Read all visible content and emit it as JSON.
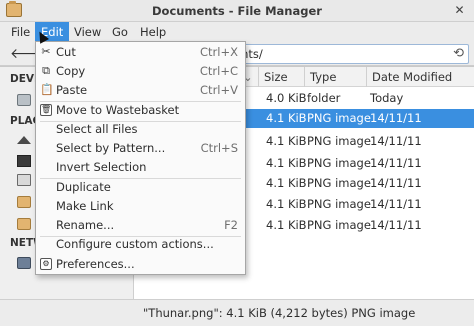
{
  "window": {
    "title": "Documents - File Manager",
    "close_glyph": "✕",
    "app_icon": "folder-icon"
  },
  "menubar": {
    "items": [
      "File",
      "Edit",
      "View",
      "Go",
      "Help"
    ],
    "active": "Edit"
  },
  "toolbar": {
    "back_glyph": "🡐",
    "path": "ents/",
    "reload_glyph": "⟲"
  },
  "sidebar": {
    "devices_heading": "DEVI",
    "places_heading": "PLAC",
    "network_heading": "NETW"
  },
  "columns": {
    "size": "Size",
    "type": "Type",
    "date": "Date Modified",
    "sort_glyph": "⌄"
  },
  "files": [
    {
      "size": "4.0 KiB",
      "type": "folder",
      "date": "Today",
      "selected": false
    },
    {
      "size": "4.1 KiB",
      "type": "PNG image",
      "date": "14/11/11",
      "selected": true
    },
    {
      "size": "4.1 KiB",
      "type": "PNG image",
      "date": "14/11/11",
      "selected": false
    },
    {
      "size": "4.1 KiB",
      "type": "PNG image",
      "date": "14/11/11",
      "selected": false
    },
    {
      "size": "4.1 KiB",
      "type": "PNG image",
      "date": "14/11/11",
      "selected": false
    },
    {
      "size": "4.1 KiB",
      "type": "PNG image",
      "date": "14/11/11",
      "selected": false
    },
    {
      "size": "4.1 KiB",
      "type": "PNG image",
      "date": "14/11/11",
      "selected": false
    }
  ],
  "status": "\"Thunar.png\": 4.1 KiB (4,212 bytes) PNG image",
  "edit_menu": {
    "cut": {
      "label": "Cut",
      "accel": "Ctrl+X",
      "icon": "✂"
    },
    "copy": {
      "label": "Copy",
      "accel": "Ctrl+C",
      "icon": "⧉"
    },
    "paste": {
      "label": "Paste",
      "accel": "Ctrl+V",
      "icon": "📋"
    },
    "wastebasket": {
      "label": "Move to Wastebasket",
      "icon": "🗑"
    },
    "select_all": {
      "label": "Select all Files"
    },
    "select_pattern": {
      "label": "Select by Pattern...",
      "accel": "Ctrl+S"
    },
    "invert": {
      "label": "Invert Selection"
    },
    "duplicate": {
      "label": "Duplicate"
    },
    "make_link": {
      "label": "Make Link"
    },
    "rename": {
      "label": "Rename...",
      "accel": "F2"
    },
    "custom_actions": {
      "label": "Configure custom actions..."
    },
    "preferences": {
      "label": "Preferences...",
      "icon": "⚙"
    }
  }
}
